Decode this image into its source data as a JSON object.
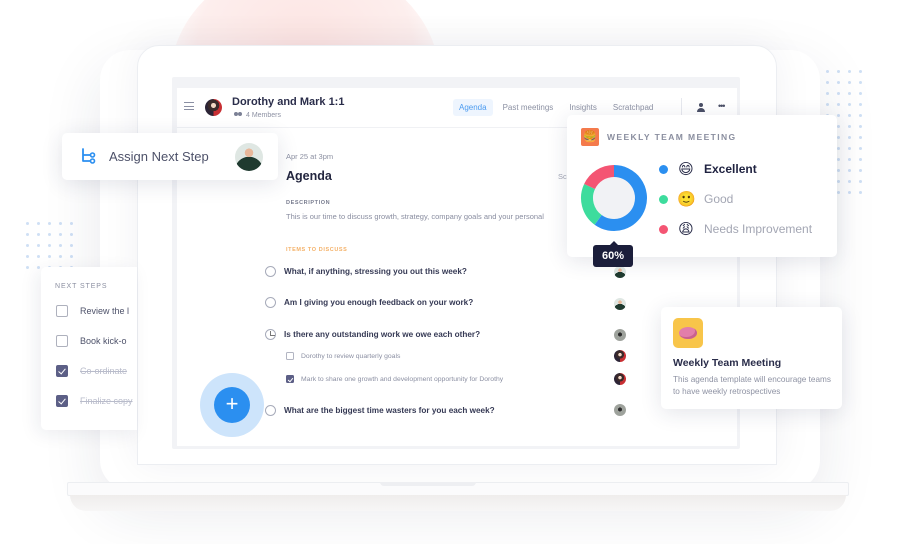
{
  "app_header": {
    "meeting_title": "Dorothy and Mark 1:1",
    "members": "4 Members",
    "tabs": [
      {
        "label": "Agenda",
        "active": true
      },
      {
        "label": "Past meetings",
        "active": false
      },
      {
        "label": "Insights",
        "active": false
      },
      {
        "label": "Scratchpad",
        "active": false
      }
    ],
    "icons": [
      "menu-icon",
      "add-person-icon",
      "more-icon"
    ],
    "more_glyph": "•••"
  },
  "agenda": {
    "date": "Apr 25 at 3pm",
    "title": "Agenda",
    "clipped_text": "Sc",
    "description_label": "DESCRIPTION",
    "description": "This is our time to discuss growth, strategy, company goals and your personal",
    "items_label": "ITEMS TO DISCUSS",
    "questions": [
      {
        "text": "What, if anything, stressing you out this week?",
        "state": "open",
        "owner": "mark"
      },
      {
        "text": "Am I giving you enough feedback on your work?",
        "state": "open",
        "owner": "mark"
      },
      {
        "text": "Is there any outstanding work we owe each other?",
        "state": "partial",
        "owner": "other"
      },
      {
        "text": "What are the biggest time wasters for you each week?",
        "state": "open",
        "owner": "other"
      }
    ],
    "sub_items": [
      {
        "text": "Dorothy to review quarterly goals",
        "checked": false,
        "owner": "dorothy"
      },
      {
        "text": "Mark to share one growth and development opportunity for Dorothy",
        "checked": true,
        "owner": "dorothy"
      }
    ]
  },
  "fab": {
    "glyph": "+",
    "label": "add-item"
  },
  "assign_card": {
    "label": "Assign Next Step",
    "icon": "branch-icon"
  },
  "next_steps": {
    "title": "NEXT STEPS",
    "items": [
      {
        "text": "Review the l",
        "checked": false
      },
      {
        "text": "Book kick-o",
        "checked": false
      },
      {
        "text": "Co-ordinate",
        "checked": true
      },
      {
        "text": "Finalize copy",
        "checked": true
      }
    ]
  },
  "weekly_card": {
    "icon_glyph": "🍔",
    "title": "WEEKLY TEAM MEETING",
    "tooltip": "60%",
    "legend": [
      {
        "label": "Excellent",
        "emoji": "😄",
        "color": "#2b8ff0",
        "value": 60
      },
      {
        "label": "Good",
        "emoji": "🙂",
        "color": "#3ddc9d",
        "value": 22
      },
      {
        "label": "Needs Improvement",
        "emoji": "😩",
        "color": "#f45573",
        "value": 18
      }
    ]
  },
  "template_card": {
    "title": "Weekly Team Meeting",
    "description": "This agenda template will encourage teams to have weekly retrospectives"
  },
  "colors": {
    "accent": "#2b8ff0",
    "dark": "#1b1e3b",
    "orange": "#f47a4c",
    "yellow": "#f8c54a"
  }
}
